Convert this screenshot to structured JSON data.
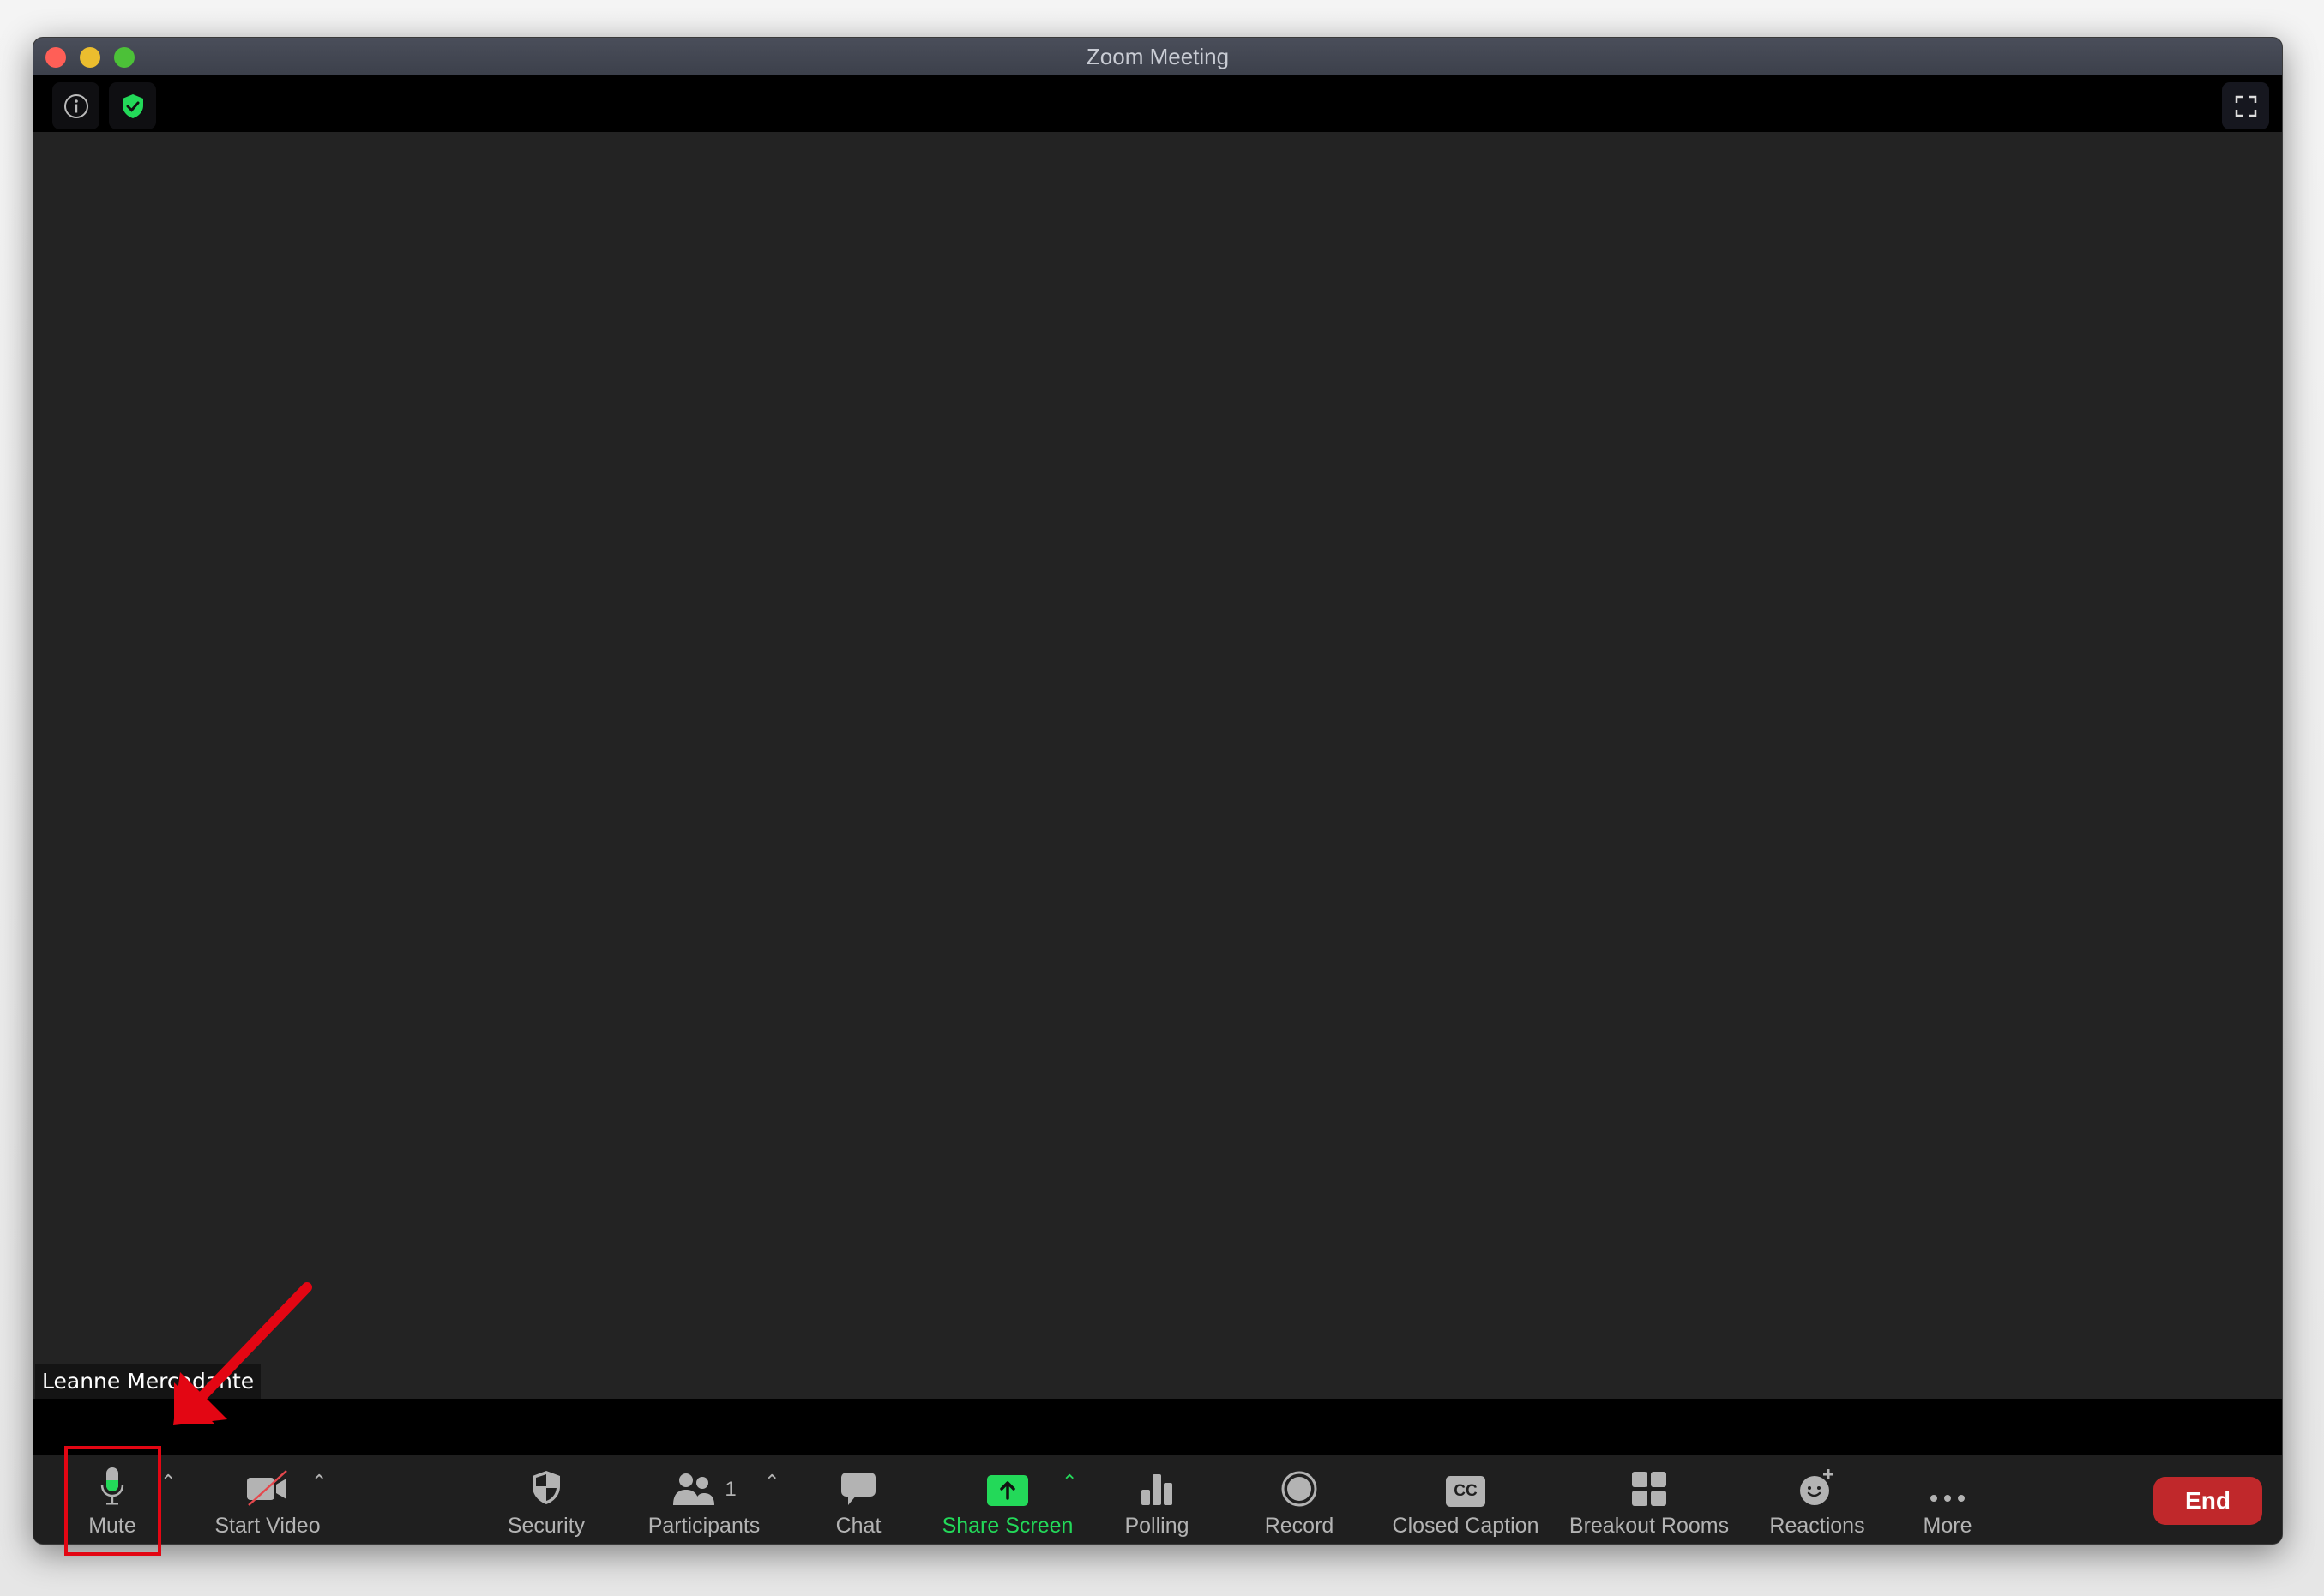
{
  "window": {
    "title": "Zoom Meeting",
    "traffic_lights": {
      "close": "#ff5f57",
      "minimize": "#ebbd2e",
      "maximize": "#4cc138"
    }
  },
  "topbar": {
    "info_icon": "info-icon",
    "security_status_icon": "shield-check-icon",
    "fullscreen_icon": "fullscreen-icon"
  },
  "video": {
    "participant_name": "Leanne Mercadante"
  },
  "toolbar": {
    "mute": {
      "label": "Mute",
      "icon": "microphone-icon",
      "has_menu": true
    },
    "start_video": {
      "label": "Start Video",
      "icon": "video-off-icon",
      "has_menu": true
    },
    "security": {
      "label": "Security",
      "icon": "shield-icon"
    },
    "participants": {
      "label": "Participants",
      "icon": "participants-icon",
      "count": "1",
      "has_menu": true
    },
    "chat": {
      "label": "Chat",
      "icon": "chat-icon"
    },
    "share_screen": {
      "label": "Share Screen",
      "icon": "share-screen-icon",
      "has_menu": true
    },
    "polling": {
      "label": "Polling",
      "icon": "polling-icon"
    },
    "record": {
      "label": "Record",
      "icon": "record-icon"
    },
    "closed_caption": {
      "label": "Closed Caption",
      "icon": "cc-icon",
      "icon_text": "CC"
    },
    "breakout_rooms": {
      "label": "Breakout Rooms",
      "icon": "breakout-rooms-icon"
    },
    "reactions": {
      "label": "Reactions",
      "icon": "reactions-icon"
    },
    "more": {
      "label": "More",
      "icon": "more-icon"
    },
    "end": {
      "label": "End"
    }
  },
  "colors": {
    "accent_green": "#23d959",
    "end_red": "#c0282b",
    "annotation_red": "#e30613",
    "icon_gray": "#b3b3b3"
  },
  "annotation": {
    "type": "arrow-and-box",
    "target": "mute"
  }
}
